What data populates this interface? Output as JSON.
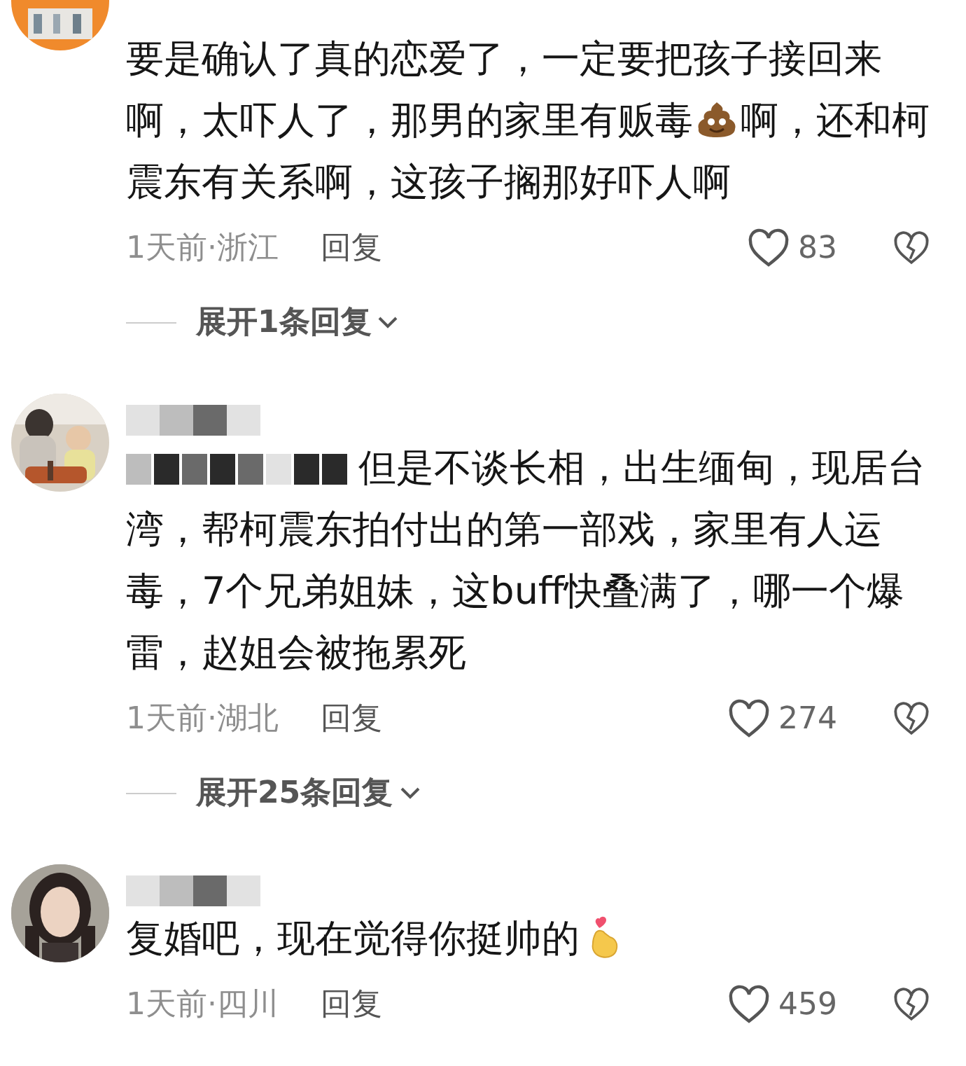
{
  "comments": [
    {
      "avatar": {
        "kind": "picture"
      },
      "parts": [
        {
          "kind": "text",
          "text": "要是确认了真的恋爱了，一定要把孩子接回来啊，太吓人了，那男的家里有贩毒"
        },
        {
          "kind": "poop"
        },
        {
          "kind": "text",
          "text": "啊，还和柯震东有关系啊，这孩子搁那好吓人啊"
        }
      ],
      "meta": "1天前·浙江",
      "reply": "回复",
      "likes": "83",
      "expand": "展开1条回复"
    },
    {
      "avatar": {
        "kind": "picture"
      },
      "name": {
        "kind": "redacted"
      },
      "parts": [
        {
          "kind": "redaction"
        },
        {
          "kind": "text",
          "text": "但是不谈长相，出生缅甸，现居台湾，帮柯震东拍付出的第一部戏，家里有人运毒，7个兄弟姐妹，这buff快叠满了，哪一个爆雷，赵姐会被拖累死"
        }
      ],
      "meta": "1天前·湖北",
      "reply": "回复",
      "likes": "274",
      "expand": "展开25条回复"
    },
    {
      "avatar": {
        "kind": "picture"
      },
      "name": {
        "kind": "redacted"
      },
      "parts": [
        {
          "kind": "text",
          "text": "复婚吧，现在觉得你挺帅的"
        },
        {
          "kind": "finger-heart"
        }
      ],
      "meta": "1天前·四川",
      "reply": "回复",
      "likes": "459"
    }
  ]
}
